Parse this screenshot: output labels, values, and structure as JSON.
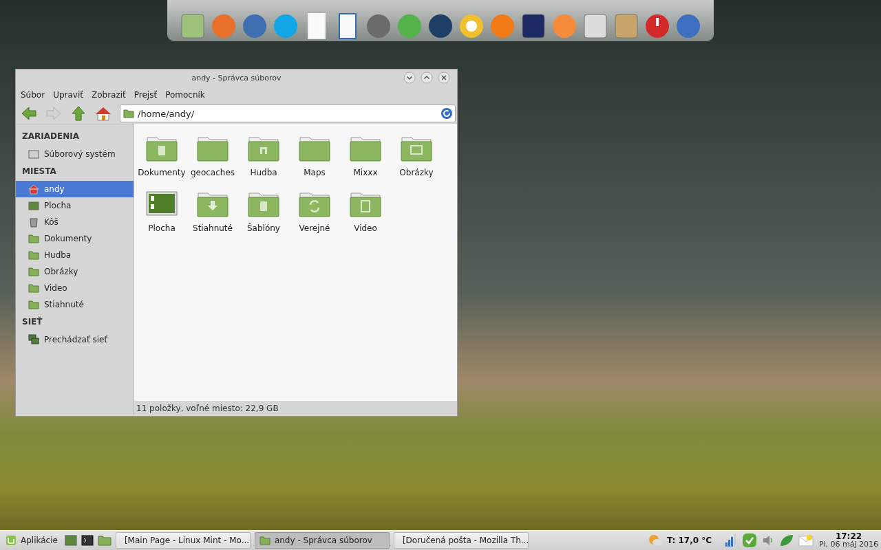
{
  "window": {
    "title": "andy - Správca súborov",
    "menu": [
      "Súbor",
      "Upraviť",
      "Zobraziť",
      "Prejsť",
      "Pomocník"
    ],
    "location": "/home/andy/",
    "sidebar": [
      {
        "heading": "ZARIADENIA",
        "items": [
          {
            "label": "Súborový systém",
            "kind": "drive",
            "selected": false
          }
        ]
      },
      {
        "heading": "MIESTA",
        "items": [
          {
            "label": "andy",
            "kind": "home",
            "selected": true
          },
          {
            "label": "Plocha",
            "kind": "desktop",
            "selected": false
          },
          {
            "label": "Kôš",
            "kind": "trash",
            "selected": false
          },
          {
            "label": "Dokumenty",
            "kind": "documents",
            "selected": false
          },
          {
            "label": "Hudba",
            "kind": "music",
            "selected": false
          },
          {
            "label": "Obrázky",
            "kind": "pictures",
            "selected": false
          },
          {
            "label": "Video",
            "kind": "video",
            "selected": false
          },
          {
            "label": "Stiahnuté",
            "kind": "download",
            "selected": false
          }
        ]
      },
      {
        "heading": "SIEŤ",
        "items": [
          {
            "label": "Prechádzať sieť",
            "kind": "network",
            "selected": false
          }
        ]
      }
    ],
    "files": [
      {
        "name": "Dokumenty",
        "kind": "documents"
      },
      {
        "name": "geocaches",
        "kind": "folder"
      },
      {
        "name": "Hudba",
        "kind": "music"
      },
      {
        "name": "Maps",
        "kind": "folder"
      },
      {
        "name": "Mixxx",
        "kind": "folder"
      },
      {
        "name": "Obrázky",
        "kind": "pictures"
      },
      {
        "name": "Plocha",
        "kind": "desktop"
      },
      {
        "name": "Stiahnuté",
        "kind": "download"
      },
      {
        "name": "Šablóny",
        "kind": "documents"
      },
      {
        "name": "Verejné",
        "kind": "public"
      },
      {
        "name": "Video",
        "kind": "video"
      }
    ],
    "status_bar": "11 položky, voľné miesto: 22,9 GB"
  },
  "taskbar": {
    "menu_button": "Aplikácie",
    "tasks": [
      {
        "title": "[Main Page - Linux Mint - Mo...",
        "kind": "browser",
        "selected": false
      },
      {
        "title": "andy - Správca súborov",
        "kind": "files",
        "selected": true
      },
      {
        "title": "[Doručená pošta - Mozilla Th...",
        "kind": "mail",
        "selected": false
      }
    ],
    "weather": "T: 17,0 °C",
    "time": "17:22",
    "date": "Pi, 06 máj 2016"
  }
}
